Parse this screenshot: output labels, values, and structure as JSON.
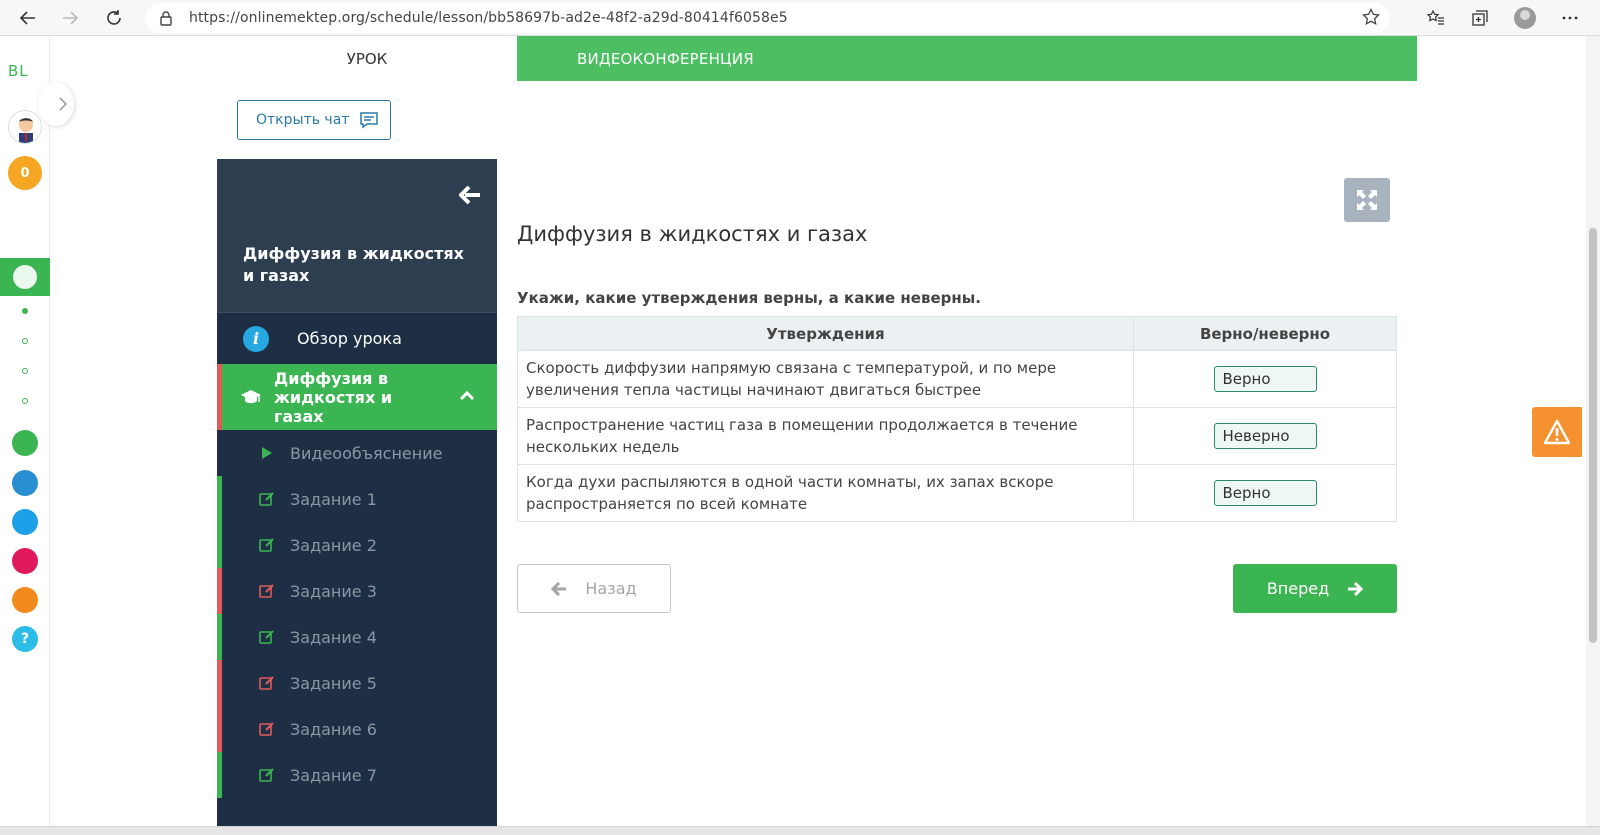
{
  "browser": {
    "url": "https://onlinemektep.org/schedule/lesson/bb58697b-ad2e-48f2-a29d-80414f6058e5"
  },
  "rail": {
    "logo": "BL",
    "coins": "0"
  },
  "tabs": {
    "lesson": "УРОК",
    "video": "ВИДЕОКОНФЕРЕНЦИЯ"
  },
  "chat": {
    "label": "Открыть чат"
  },
  "sidebar": {
    "title": "Диффузия в жидкостях и газах",
    "overview": "Обзор урока",
    "topic": "Диффузия в жидкостях и газах",
    "items": [
      {
        "label": "Видеообъяснение",
        "status": "video"
      },
      {
        "label": "Задание 1",
        "status": "green"
      },
      {
        "label": "Задание 2",
        "status": "green"
      },
      {
        "label": "Задание 3",
        "status": "red"
      },
      {
        "label": "Задание 4",
        "status": "green"
      },
      {
        "label": "Задание 5",
        "status": "red"
      },
      {
        "label": "Задание 6",
        "status": "red"
      },
      {
        "label": "Задание 7",
        "status": "green"
      }
    ]
  },
  "content": {
    "title": "Диффузия в жидкостях и газах",
    "question": "Укажи, какие утверждения верны, а какие неверны.",
    "headers": [
      "Утверждения",
      "Верно/неверно"
    ],
    "rows": [
      {
        "statement": "Скорость диффузии напрямую связана с температурой, и по мере увеличения тепла частицы начинают двигаться быстрее",
        "answer": "Верно"
      },
      {
        "statement": "Распространение частиц газа в помещении продолжается в течение нескольких недель",
        "answer": "Неверно"
      },
      {
        "statement": "Когда духи распыляются в одной части комнаты, их запах вскоре распространяется по всей комнате",
        "answer": "Верно"
      }
    ],
    "back": "Назад",
    "forward": "Вперед"
  },
  "colors": {
    "green": "#3bb552",
    "sidebar": "#1e2f45",
    "red": "#e05a5a",
    "warn": "#f5922f"
  }
}
